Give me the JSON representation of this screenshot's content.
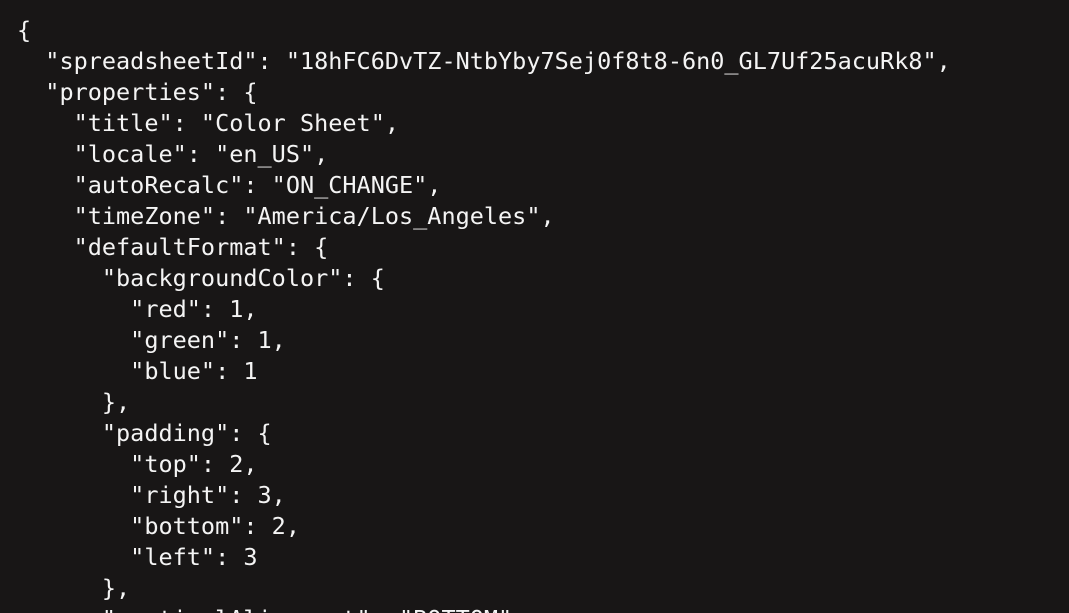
{
  "theme": {
    "background": "#181616",
    "text": "#f4f4f4"
  },
  "lines": [
    "{",
    "  \"spreadsheetId\": \"18hFC6DvTZ-NtbYby7Sej0f8t8-6n0_GL7Uf25acuRk8\",",
    "  \"properties\": {",
    "    \"title\": \"Color Sheet\",",
    "    \"locale\": \"en_US\",",
    "    \"autoRecalc\": \"ON_CHANGE\",",
    "    \"timeZone\": \"America/Los_Angeles\",",
    "    \"defaultFormat\": {",
    "      \"backgroundColor\": {",
    "        \"red\": 1,",
    "        \"green\": 1,",
    "        \"blue\": 1",
    "      },",
    "      \"padding\": {",
    "        \"top\": 2,",
    "        \"right\": 3,",
    "        \"bottom\": 2,",
    "        \"left\": 3",
    "      },",
    "      \"verticalAlignment\": \"BOTTOM\","
  ]
}
